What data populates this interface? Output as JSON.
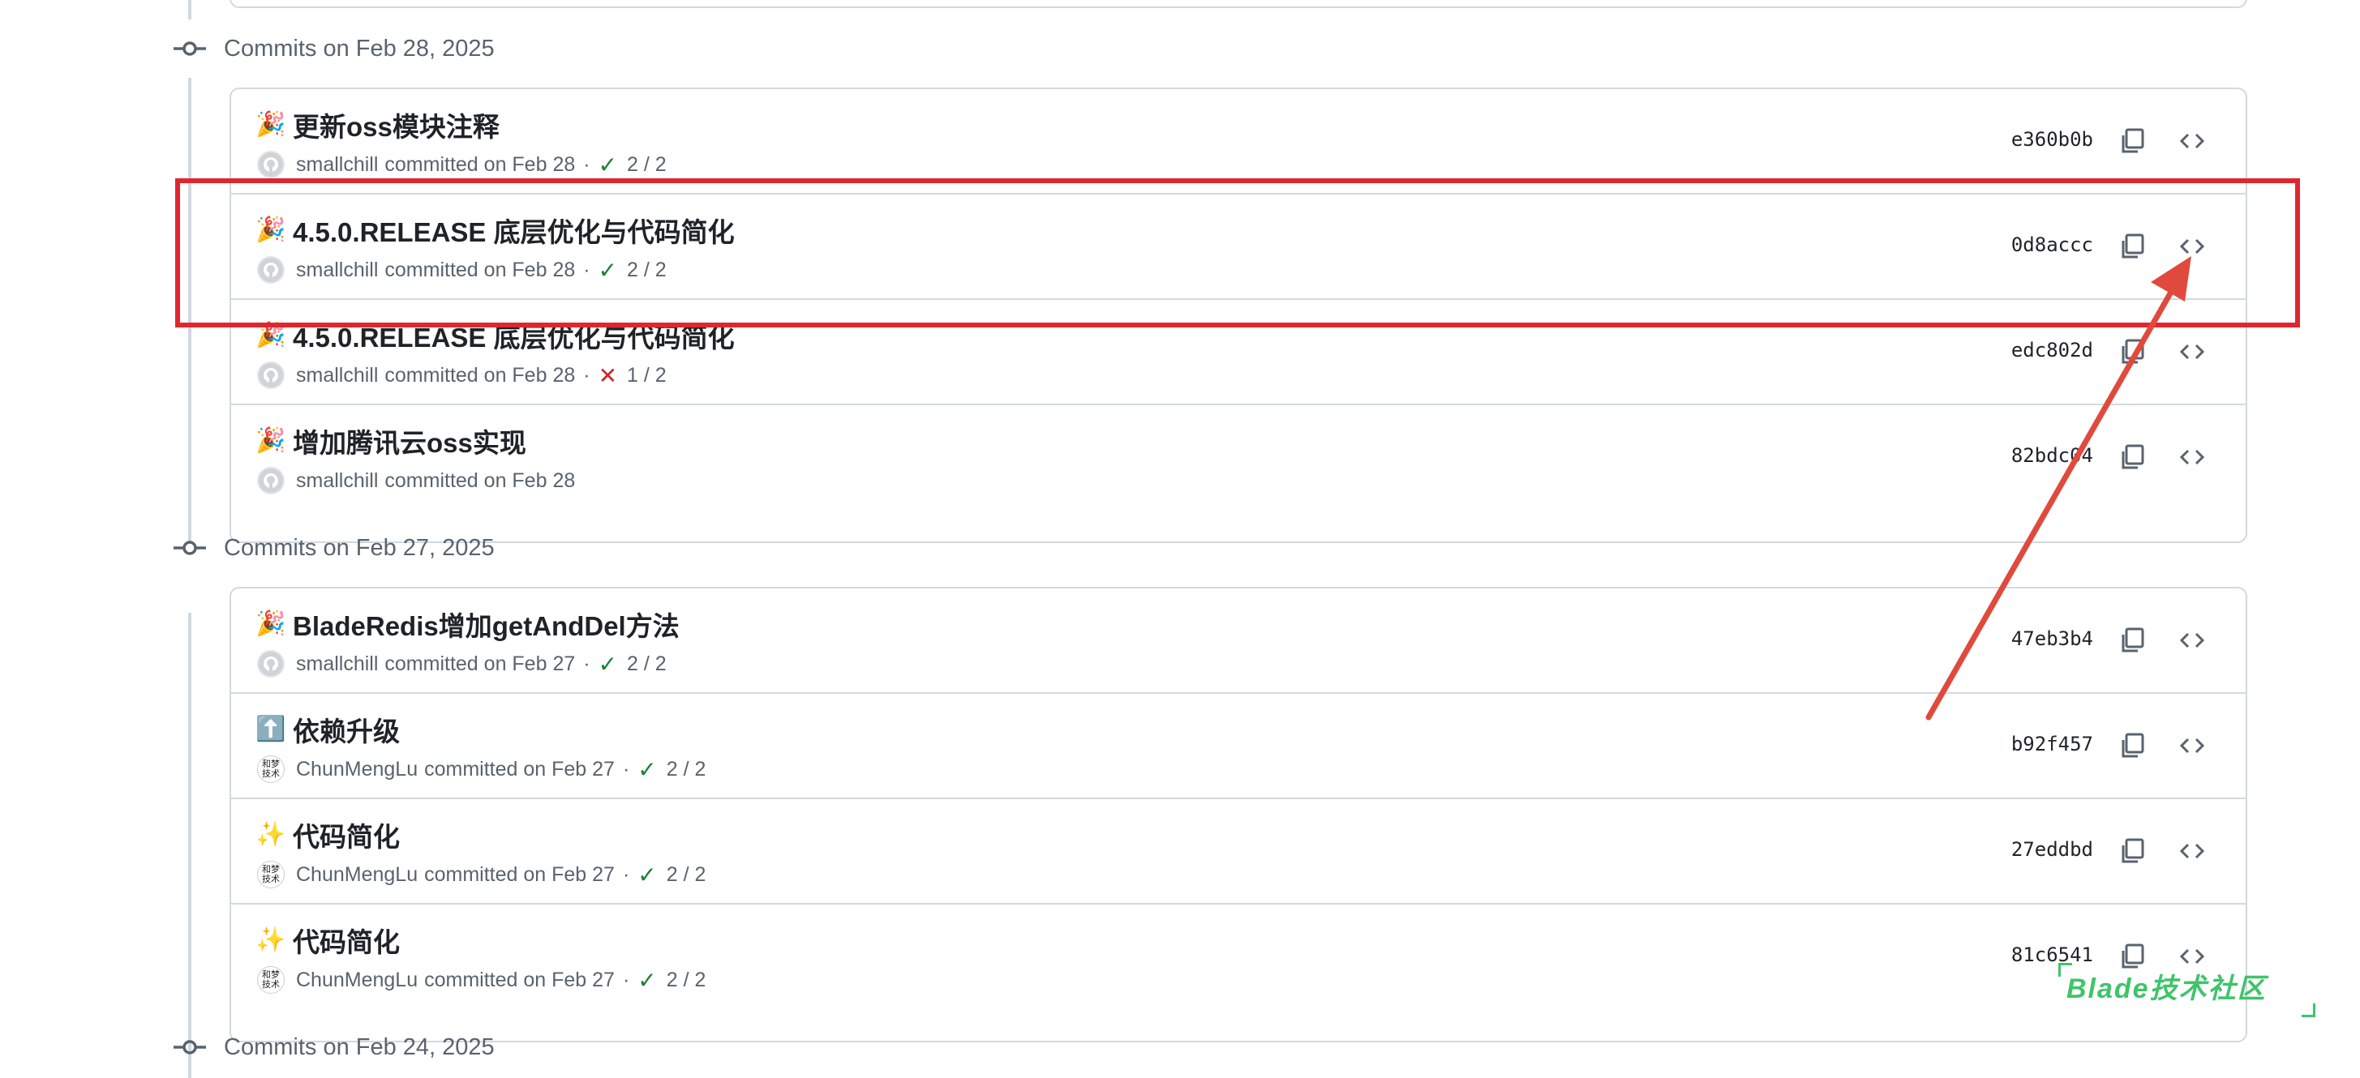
{
  "groups": [
    {
      "date": "Commits on Feb 28, 2025",
      "commits": [
        {
          "emoji": "🎉",
          "message": "更新oss模块注释",
          "author": "smallchill",
          "committed": "committed on Feb 28",
          "status": "pass",
          "checks": "2 / 2",
          "sha": "e360b0b",
          "avatar": "github"
        },
        {
          "emoji": "🎉",
          "message": "4.5.0.RELEASE 底层优化与代码简化",
          "author": "smallchill",
          "committed": "committed on Feb 28",
          "status": "pass",
          "checks": "2 / 2",
          "sha": "0d8accc",
          "avatar": "github"
        },
        {
          "emoji": "🎉",
          "message": "4.5.0.RELEASE 底层优化与代码简化",
          "author": "smallchill",
          "committed": "committed on Feb 28",
          "status": "fail",
          "checks": "1 / 2",
          "sha": "edc802d",
          "avatar": "github"
        },
        {
          "emoji": "🎉",
          "message": "增加腾讯云oss实现",
          "author": "smallchill",
          "committed": "committed on Feb 28",
          "status": "none",
          "checks": "",
          "sha": "82bdc04",
          "avatar": "github"
        }
      ]
    },
    {
      "date": "Commits on Feb 27, 2025",
      "commits": [
        {
          "emoji": "🎉",
          "message": "BladeRedis增加getAndDel方法",
          "author": "smallchill",
          "committed": "committed on Feb 27",
          "status": "pass",
          "checks": "2 / 2",
          "sha": "47eb3b4",
          "avatar": "github"
        },
        {
          "emoji": "⬆️",
          "message": "依赖升级",
          "author": "ChunMengLu",
          "committed": "committed on Feb 27",
          "status": "pass",
          "checks": "2 / 2",
          "sha": "b92f457",
          "avatar": "chunmeng"
        },
        {
          "emoji": "✨",
          "message": "代码简化",
          "author": "ChunMengLu",
          "committed": "committed on Feb 27",
          "status": "pass",
          "checks": "2 / 2",
          "sha": "27eddbd",
          "avatar": "chunmeng"
        },
        {
          "emoji": "✨",
          "message": "代码简化",
          "author": "ChunMengLu",
          "committed": "committed on Feb 27",
          "status": "pass",
          "checks": "2 / 2",
          "sha": "81c6541",
          "avatar": "chunmeng"
        }
      ]
    },
    {
      "date": "Commits on Feb 24, 2025",
      "commits": []
    }
  ],
  "avatar_text": {
    "chunmeng": "和梦技术"
  },
  "icons": {
    "timeline": "git-commit-icon",
    "copy": "copy-icon",
    "browse": "code-icon",
    "pass": "check-icon",
    "fail": "x-icon",
    "avatar": "github-avatar-icon"
  },
  "colors": {
    "highlight": "#e0262f",
    "arrow": "#e04a3c",
    "pass": "#1a7f37",
    "fail": "#d1242f",
    "watermark": "#3fc46a"
  },
  "watermark": "Blade技术社区"
}
